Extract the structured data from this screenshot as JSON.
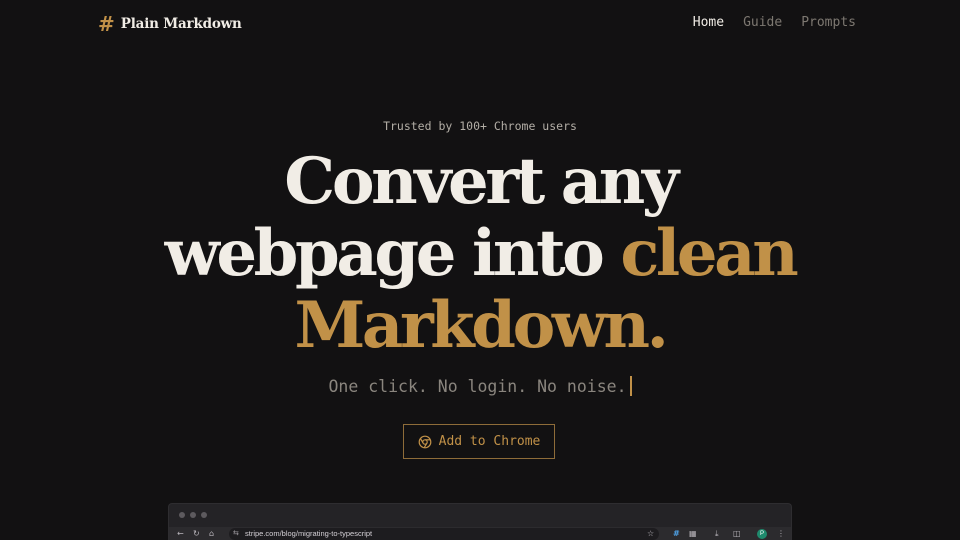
{
  "brand": {
    "icon": "hash-icon",
    "symbol": "#",
    "name": "Plain Markdown"
  },
  "nav": {
    "items": [
      {
        "label": "Home",
        "active": true
      },
      {
        "label": "Guide",
        "active": false
      },
      {
        "label": "Prompts",
        "active": false
      }
    ]
  },
  "hero": {
    "trusted": "Trusted by 100+ Chrome users",
    "headline_line1": "Convert any",
    "headline_line2_plain": "webpage into ",
    "headline_line2_accent": "clean",
    "headline_line3_accent": "Markdown.",
    "tagline": "One click. No login. No noise.",
    "cta_label": "Add to Chrome",
    "cta_icon": "chrome-icon"
  },
  "browser_preview": {
    "url": "stripe.com/blog/migrating-to-typescript",
    "profile_initial": "P"
  },
  "colors": {
    "background": "#121112",
    "text": "#f1ede6",
    "accent": "#c19148",
    "muted": "#7d7871"
  }
}
